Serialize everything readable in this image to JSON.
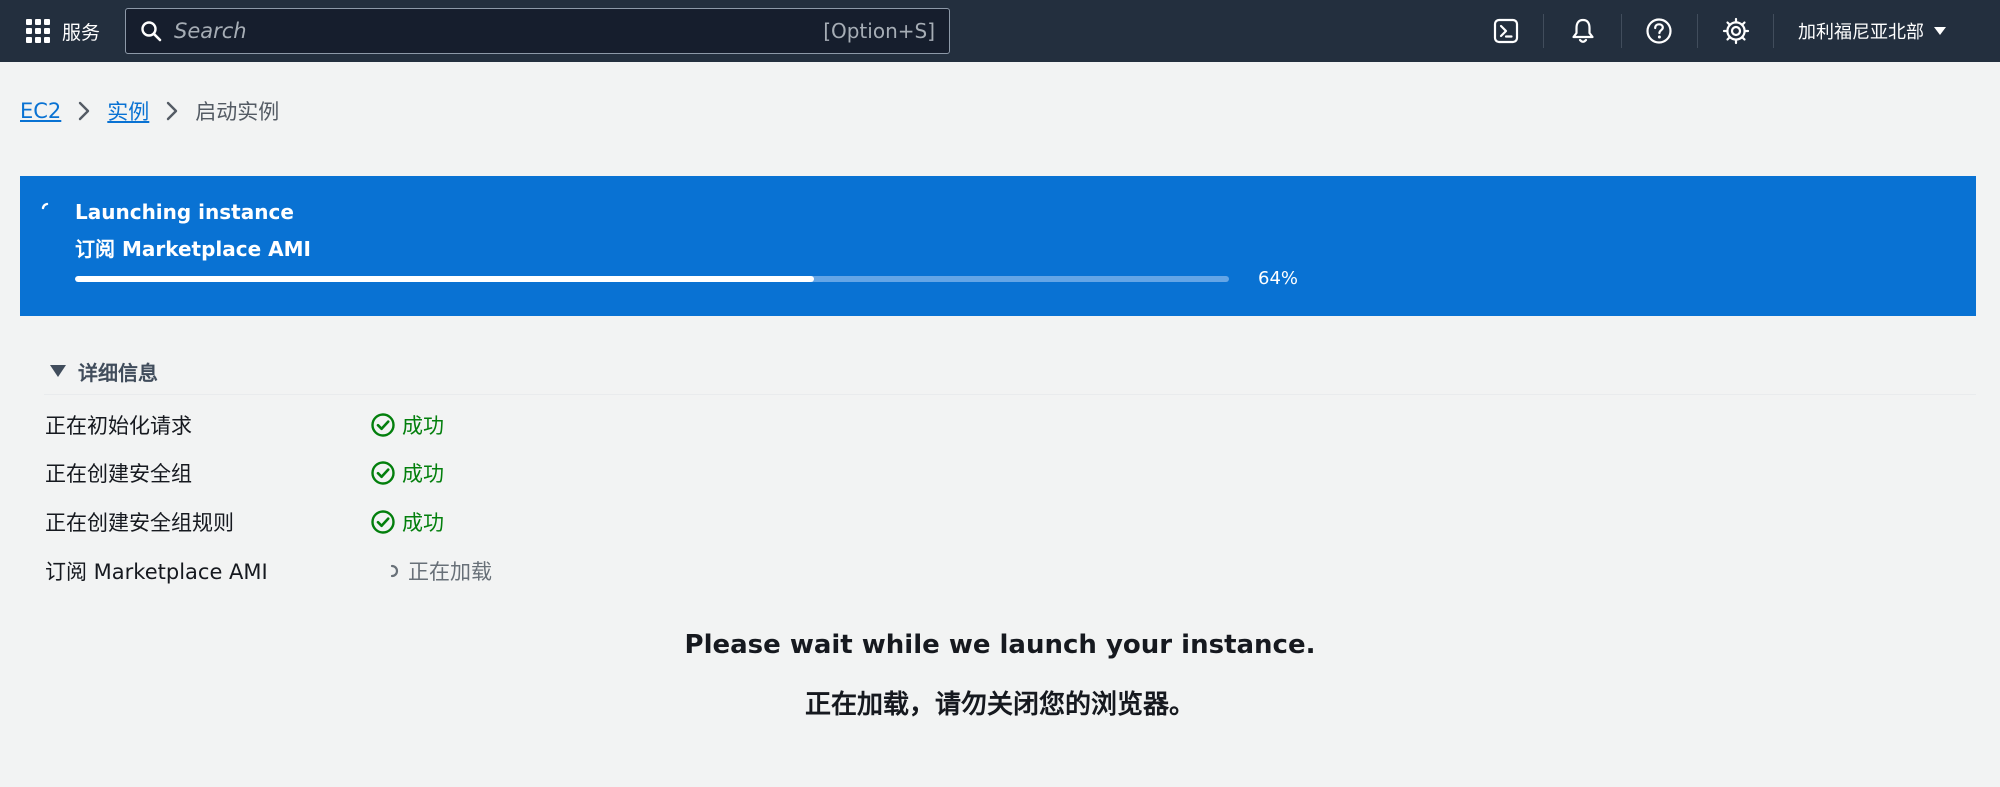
{
  "topnav": {
    "services_label": "服务",
    "search_placeholder": "Search",
    "search_shortcut": "[Option+S]",
    "icons": [
      "cloudshell-icon",
      "bell-icon",
      "help-icon",
      "gear-icon"
    ],
    "region_label": "加利福尼亚北部"
  },
  "breadcrumb": {
    "items": [
      "EC2",
      "实例"
    ],
    "current": "启动实例"
  },
  "flash": {
    "title": "Launching instance",
    "subtitle": "订阅 Marketplace AMI",
    "progress_percent": 64,
    "progress_label": "64%",
    "background_color": "#0972d3"
  },
  "details": {
    "header": "详细信息",
    "steps": [
      {
        "label": "正在初始化请求",
        "status": "成功",
        "state": "success"
      },
      {
        "label": "正在创建安全组",
        "status": "成功",
        "state": "success"
      },
      {
        "label": "正在创建安全组规则",
        "status": "成功",
        "state": "success"
      },
      {
        "label": "订阅 Marketplace AMI",
        "status": "正在加载",
        "state": "loading"
      }
    ]
  },
  "messages": {
    "wait_en": "Please wait while we launch your instance.",
    "wait_zh": "正在加载，请勿关闭您的浏览器。"
  },
  "colors": {
    "nav_bg": "#232f3e",
    "link": "#0972d3",
    "success": "#037f0c"
  }
}
